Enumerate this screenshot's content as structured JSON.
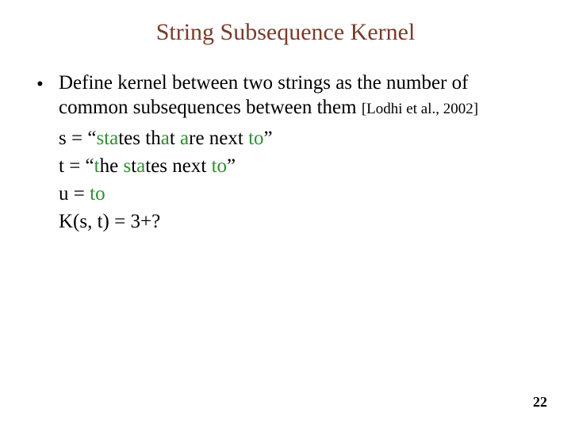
{
  "title": "String Subsequence Kernel",
  "bullet": {
    "dot": "•",
    "text_a": "Define kernel between two strings as the number of common subsequences between them ",
    "citation": "[Lodhi et al., 2002]"
  },
  "example": {
    "s_pre": "s = “",
    "s_word_s": "s",
    "s_word_t": "t",
    "s_word_a": "a",
    "s_mid1": "tes th",
    "s_mid2": "t ",
    "s_mid3": "re next ",
    "s_to_t": "t",
    "s_to_o": "o",
    "s_post": "”",
    "t_pre": "t = “",
    "t_word_t": "t",
    "t_mid1": "he ",
    "t_word_s": "s",
    "t_mid2": "t",
    "t_word_a": "a",
    "t_mid3": "tes next ",
    "t_to_t": "t",
    "t_to_o": "o",
    "t_post": "”",
    "u_pre": "u = ",
    "u_t": "t",
    "u_o": "o",
    "k_line": "K(s, t) = 3+?"
  },
  "page_number": "22"
}
